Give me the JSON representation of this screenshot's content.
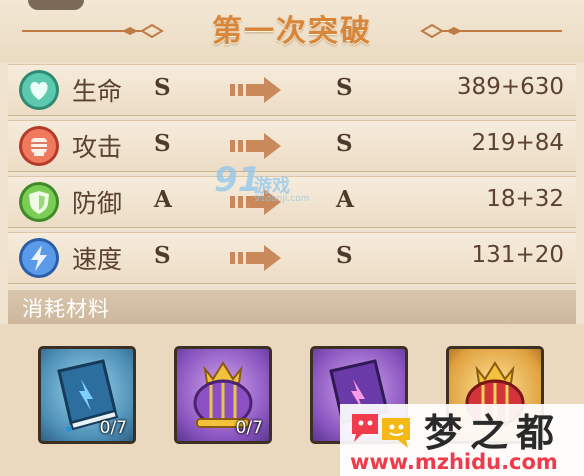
{
  "title": "第一次突破",
  "stats": [
    {
      "name": "生命",
      "from": "S",
      "to": "S",
      "value": "389+630",
      "icon": "heart-icon",
      "color": "#3fb39a"
    },
    {
      "name": "攻击",
      "from": "S",
      "to": "S",
      "value": "219+84",
      "icon": "fist-icon",
      "color": "#e3533f"
    },
    {
      "name": "防御",
      "from": "A",
      "to": "A",
      "value": "18+32",
      "icon": "shield-icon",
      "color": "#5fb540"
    },
    {
      "name": "速度",
      "from": "S",
      "to": "S",
      "value": "131+20",
      "icon": "lightning-icon",
      "color": "#3d7fd6"
    }
  ],
  "materials_header": "消耗材料",
  "materials": [
    {
      "name": "blue-book",
      "count": "0/7"
    },
    {
      "name": "purple-crown",
      "count": "0/7"
    },
    {
      "name": "purple-book",
      "count": ""
    },
    {
      "name": "gold-crown",
      "count": ""
    }
  ],
  "watermarks": {
    "game91_number": "91",
    "game91_text": "游戏",
    "game91_sub": "91danji.com",
    "mzhidu_name": "梦之都",
    "mzhidu_url": "www.mzhidu.com"
  },
  "colors": {
    "background": "#efe3cf",
    "title": "#d8863a",
    "arrow": "#c9895a",
    "text": "#5b4230"
  }
}
